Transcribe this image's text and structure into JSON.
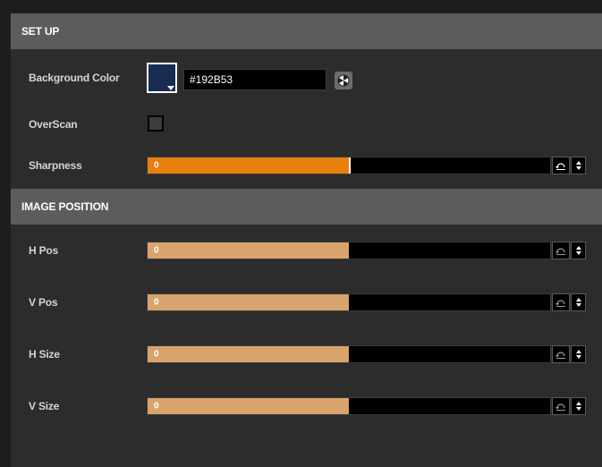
{
  "setup": {
    "title": "SET UP",
    "background_color": {
      "label": "Background Color",
      "value": "#192B53",
      "swatch": "#192b53"
    },
    "overscan": {
      "label": "OverScan",
      "checked": false
    },
    "sharpness": {
      "label": "Sharpness",
      "value": "0",
      "level_percent": 50,
      "fill_color": "#e87e0c"
    }
  },
  "image_position": {
    "title": "IMAGE POSITION",
    "rows": [
      {
        "label": "H Pos",
        "value": "0",
        "level_percent": 50,
        "fill_color": "#d9a46b"
      },
      {
        "label": "V Pos",
        "value": "0",
        "level_percent": 50,
        "fill_color": "#d9a46b"
      },
      {
        "label": "H Size",
        "value": "0",
        "level_percent": 50,
        "fill_color": "#d9a46b"
      },
      {
        "label": "V Size",
        "value": "0",
        "level_percent": 50,
        "fill_color": "#d9a46b"
      }
    ]
  },
  "icons": {
    "picker": "color-wheel-icon",
    "reset": "reset-icon",
    "spinner": "spinner-arrows-icon"
  }
}
